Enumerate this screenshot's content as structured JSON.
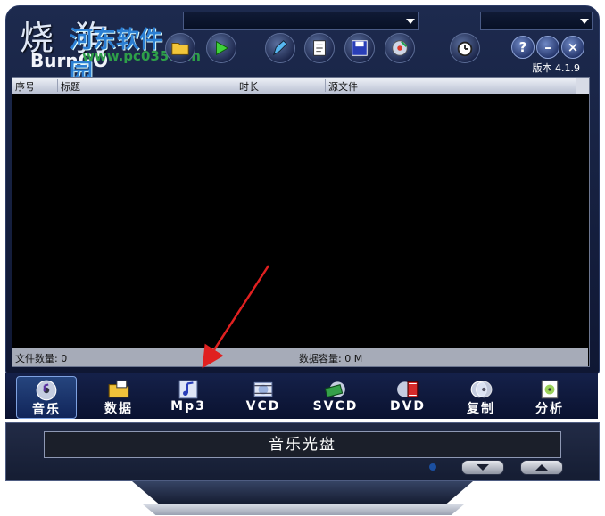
{
  "logo": {
    "cn": "烧 狗",
    "brand": "BurnGO"
  },
  "watermark": {
    "name": "河东软件园",
    "url": "www.pc0359.cn"
  },
  "version": "版本 4.1.9",
  "toolbar": {
    "icons": [
      "folder-open-icon",
      "play-icon",
      "pencil-icon",
      "document-icon",
      "save-icon",
      "burn-disc-icon",
      "timer-icon"
    ]
  },
  "controls": {
    "help": "?",
    "minimize": "–",
    "close": "×"
  },
  "list": {
    "columns": [
      "序号",
      "标题",
      "时长",
      "源文件"
    ]
  },
  "status": {
    "file_count": "文件数量: 0",
    "capacity": "数据容量: 0 M"
  },
  "modes": [
    {
      "label": "音乐",
      "icon": "music-cd-icon",
      "active": true
    },
    {
      "label": "数据",
      "icon": "data-folder-icon",
      "active": false
    },
    {
      "label": "Mp3",
      "icon": "mp3-note-icon",
      "active": false
    },
    {
      "label": "VCD",
      "icon": "vcd-icon",
      "active": false
    },
    {
      "label": "SVCD",
      "icon": "svcd-film-icon",
      "active": false
    },
    {
      "label": "DVD",
      "icon": "dvd-film-icon",
      "active": false
    },
    {
      "label": "复制",
      "icon": "copy-disc-icon",
      "active": false
    },
    {
      "label": "分析",
      "icon": "analyze-disc-icon",
      "active": false
    }
  ],
  "panel": {
    "disc_type": "音乐光盘"
  },
  "colors": {
    "frame": "#1d2a4e",
    "list_bg": "#000000",
    "accent": "#2c7fd3",
    "arrow": "#e02020"
  }
}
